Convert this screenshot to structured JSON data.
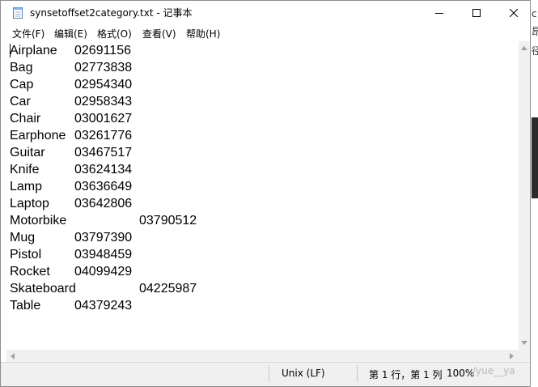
{
  "window": {
    "title": "synsetoffset2category.txt - 记事本"
  },
  "menu": [
    {
      "label": "文件(F)"
    },
    {
      "label": "编辑(E)"
    },
    {
      "label": "格式(O)"
    },
    {
      "label": "查看(V)"
    },
    {
      "label": "帮助(H)"
    }
  ],
  "lines": [
    {
      "name": "Airplane",
      "code": "02691156"
    },
    {
      "name": "Bag",
      "code": "02773838"
    },
    {
      "name": "Cap",
      "code": "02954340"
    },
    {
      "name": "Car",
      "code": "02958343"
    },
    {
      "name": "Chair",
      "code": "03001627"
    },
    {
      "name": "Earphone",
      "code": "03261776"
    },
    {
      "name": "Guitar",
      "code": "03467517"
    },
    {
      "name": "Knife",
      "code": "03624134"
    },
    {
      "name": "Lamp",
      "code": "03636649"
    },
    {
      "name": "Laptop",
      "code": "03642806"
    },
    {
      "name": "Motorbike",
      "code": "03790512"
    },
    {
      "name": "Mug",
      "code": "03797390"
    },
    {
      "name": "Pistol",
      "code": "03948459"
    },
    {
      "name": "Rocket",
      "code": "04099429"
    },
    {
      "name": "Skateboard",
      "code": "04225987"
    },
    {
      "name": "Table",
      "code": "04379243"
    }
  ],
  "status": {
    "encoding": "Unix (LF)",
    "position": "第 1 行，第 1 列",
    "zoom": "100%"
  },
  "watermark": "/yue__ya",
  "background_fragments": [
    "c",
    "昂",
    "径"
  ]
}
